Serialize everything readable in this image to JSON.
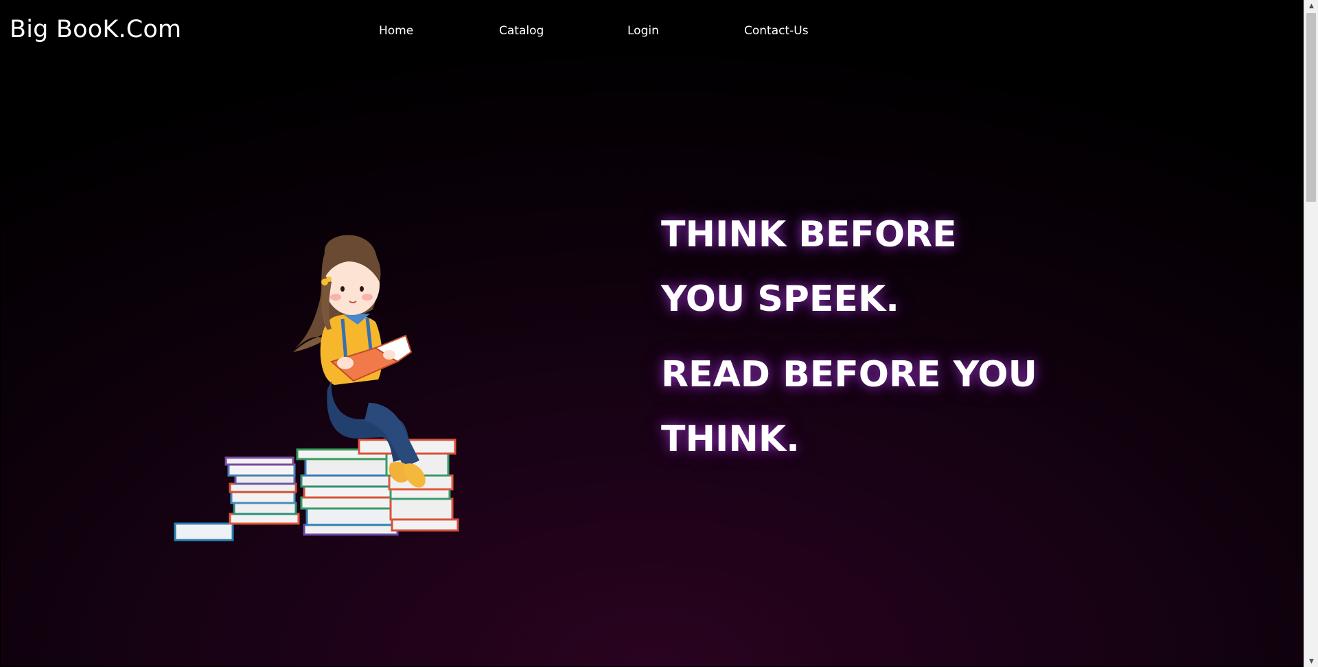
{
  "header": {
    "brand": "Big BooK.Com",
    "nav": [
      "Home",
      "Catalog",
      "Login",
      "Contact-Us"
    ]
  },
  "hero": {
    "lines": [
      "THINK BEFORE",
      "YOU SPEEK.",
      "READ BEFORE YOU",
      "THINK."
    ]
  },
  "illustration": {
    "subject": "girl-reading-on-book-stack"
  },
  "colors": {
    "background_dark": "#000000",
    "background_glow": "#2a0320",
    "text": "#ffffff",
    "text_glow": "#aa3cdc"
  }
}
